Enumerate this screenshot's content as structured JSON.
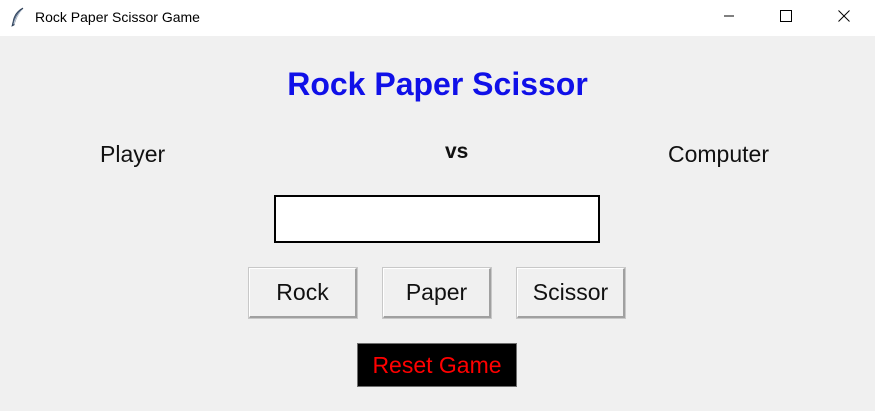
{
  "window": {
    "title": "Rock Paper Scissor Game",
    "icon": "feather-icon",
    "controls": [
      "minimize-icon",
      "maximize-icon",
      "close-icon"
    ]
  },
  "game": {
    "heading": "Rock Paper Scissor",
    "player_label": "Player",
    "vs_label": "vs",
    "computer_label": "Computer",
    "result_value": "",
    "buttons": {
      "rock": "Rock",
      "paper": "Paper",
      "scissor": "Scissor"
    },
    "reset_label": "Reset Game"
  },
  "colors": {
    "heading": "#1010e8",
    "reset_text": "#ff0000",
    "reset_bg": "#000000",
    "background": "#f0f0f0"
  }
}
